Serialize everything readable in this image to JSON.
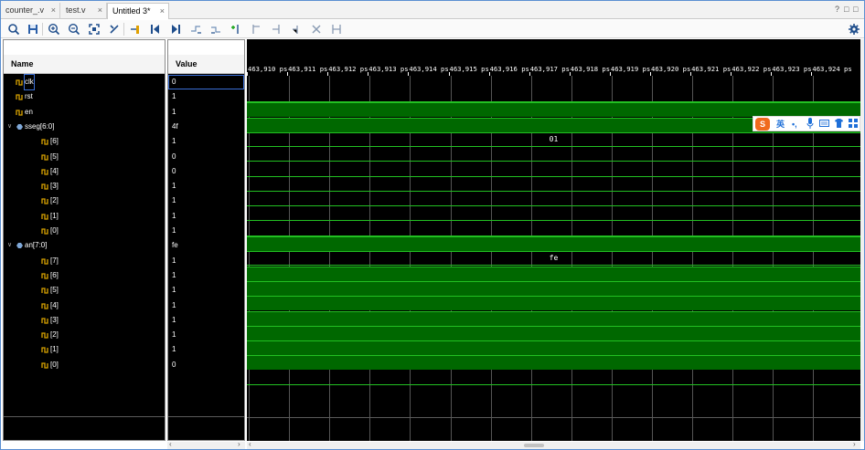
{
  "tabs": [
    {
      "label": "counter_.v",
      "active": false
    },
    {
      "label": "test.v",
      "active": false
    },
    {
      "label": "Untitled 3*",
      "active": true
    }
  ],
  "window_controls": [
    "?",
    "□",
    "□"
  ],
  "toolbar_icons": [
    "search-icon",
    "save-icon",
    "zoom-in-icon",
    "zoom-out-icon",
    "zoom-fit-icon",
    "cursor-snap-icon",
    "add-marker-icon",
    "go-to-first-icon",
    "go-to-last-icon",
    "swap-cursors-icon",
    "swap-cursors-alt-icon",
    "add-marker-plus-icon",
    "previous-marker-icon",
    "next-marker-icon",
    "previous-edge-icon",
    "delete-marker-icon",
    "unlock-marker-icon"
  ],
  "settings_icon": "gear-icon",
  "columns": {
    "name": "Name",
    "value": "Value"
  },
  "signals": [
    {
      "name": "clk",
      "value": "0",
      "level": 0,
      "kind": "wire",
      "wave": "low",
      "selected": true
    },
    {
      "name": "rst",
      "value": "1",
      "level": 0,
      "kind": "wire",
      "wave": "high"
    },
    {
      "name": "en",
      "value": "1",
      "level": 0,
      "kind": "wire",
      "wave": "high"
    },
    {
      "name": "sseg[6:0]",
      "value": "4f",
      "level": 0,
      "kind": "bus",
      "wave": "bus",
      "bus_value": "01"
    },
    {
      "name": "[6]",
      "value": "1",
      "level": 1,
      "kind": "wire",
      "wave": "low"
    },
    {
      "name": "[5]",
      "value": "0",
      "level": 1,
      "kind": "wire",
      "wave": "low"
    },
    {
      "name": "[4]",
      "value": "0",
      "level": 1,
      "kind": "wire",
      "wave": "low"
    },
    {
      "name": "[3]",
      "value": "1",
      "level": 1,
      "kind": "wire",
      "wave": "low"
    },
    {
      "name": "[2]",
      "value": "1",
      "level": 1,
      "kind": "wire",
      "wave": "low"
    },
    {
      "name": "[1]",
      "value": "1",
      "level": 1,
      "kind": "wire",
      "wave": "low"
    },
    {
      "name": "[0]",
      "value": "1",
      "level": 1,
      "kind": "wire",
      "wave": "high"
    },
    {
      "name": "an[7:0]",
      "value": "fe",
      "level": 0,
      "kind": "bus",
      "wave": "bus",
      "bus_value": "fe"
    },
    {
      "name": "[7]",
      "value": "1",
      "level": 1,
      "kind": "wire",
      "wave": "high"
    },
    {
      "name": "[6]",
      "value": "1",
      "level": 1,
      "kind": "wire",
      "wave": "high"
    },
    {
      "name": "[5]",
      "value": "1",
      "level": 1,
      "kind": "wire",
      "wave": "high"
    },
    {
      "name": "[4]",
      "value": "1",
      "level": 1,
      "kind": "wire",
      "wave": "high"
    },
    {
      "name": "[3]",
      "value": "1",
      "level": 1,
      "kind": "wire",
      "wave": "high"
    },
    {
      "name": "[2]",
      "value": "1",
      "level": 1,
      "kind": "wire",
      "wave": "high"
    },
    {
      "name": "[1]",
      "value": "1",
      "level": 1,
      "kind": "wire",
      "wave": "high"
    },
    {
      "name": "[0]",
      "value": "0",
      "level": 1,
      "kind": "wire",
      "wave": "low"
    }
  ],
  "timeline": {
    "labels": [
      "463,910 ps",
      "463,911 ps",
      "463,912 ps",
      "463,913 ps",
      "463,914 ps",
      "463,915 ps",
      "463,916 ps",
      "463,917 ps",
      "463,918 ps",
      "463,919 ps",
      "463,920 ps",
      "463,921 ps",
      "463,922 ps",
      "463,923 ps",
      "463,924 ps"
    ]
  },
  "ime": {
    "logo": "S",
    "lang": "英",
    "items": [
      "punctuation-icon",
      "microphone-icon",
      "keyboard-icon",
      "skin-icon",
      "toolbox-icon"
    ]
  },
  "colors": {
    "wave_high_fill": "#006800",
    "wave_line": "#22c022",
    "background": "#000000",
    "frame": "#5b8fd1"
  }
}
